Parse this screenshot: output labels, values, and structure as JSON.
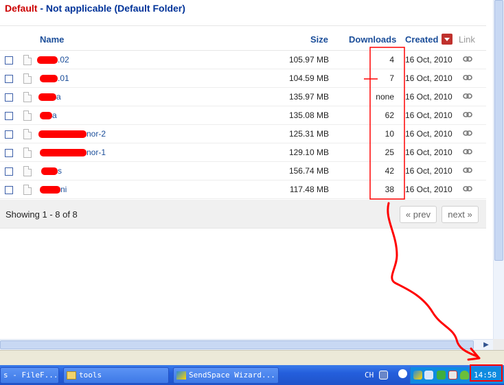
{
  "folder": {
    "default_label": "Default",
    "rest": " - Not applicable (Default Folder)"
  },
  "columns": {
    "name": "Name",
    "size": "Size",
    "downloads": "Downloads",
    "created": "Created",
    "link": "Link"
  },
  "files": [
    {
      "name_visible": ".02",
      "size": "105.97 MB",
      "downloads": "4",
      "created": "16 Oct, 2010"
    },
    {
      "name_visible": ".01",
      "size": "104.59 MB",
      "downloads": "7",
      "created": "16 Oct, 2010"
    },
    {
      "name_visible": "a",
      "size": "135.97 MB",
      "downloads": "none",
      "created": "16 Oct, 2010"
    },
    {
      "name_visible": "a",
      "size": "135.08 MB",
      "downloads": "62",
      "created": "16 Oct, 2010"
    },
    {
      "name_visible": "nor-2",
      "size": "125.31 MB",
      "downloads": "10",
      "created": "16 Oct, 2010"
    },
    {
      "name_visible": "nor-1",
      "size": "129.10 MB",
      "downloads": "25",
      "created": "16 Oct, 2010"
    },
    {
      "name_visible": "s",
      "size": "156.74 MB",
      "downloads": "42",
      "created": "16 Oct, 2010"
    },
    {
      "name_visible": "ni",
      "size": "117.48 MB",
      "downloads": "38",
      "created": "16 Oct, 2010"
    }
  ],
  "footer": {
    "showing": "Showing 1 - 8 of 8",
    "prev": "« prev",
    "next": "next »"
  },
  "taskbar": {
    "tasks": [
      "s - FileF...",
      "tools",
      "SendSpace Wizard..."
    ],
    "language": "CH",
    "clock": "14:58"
  },
  "icons": {
    "sort": "sort-desc-icon",
    "link": "chain-link-icon",
    "file": "file-icon"
  },
  "colors": {
    "link_blue": "#1a4d99",
    "default_red": "#cc0000",
    "sort_red": "#c0312d",
    "annotation": "#ff0000"
  }
}
